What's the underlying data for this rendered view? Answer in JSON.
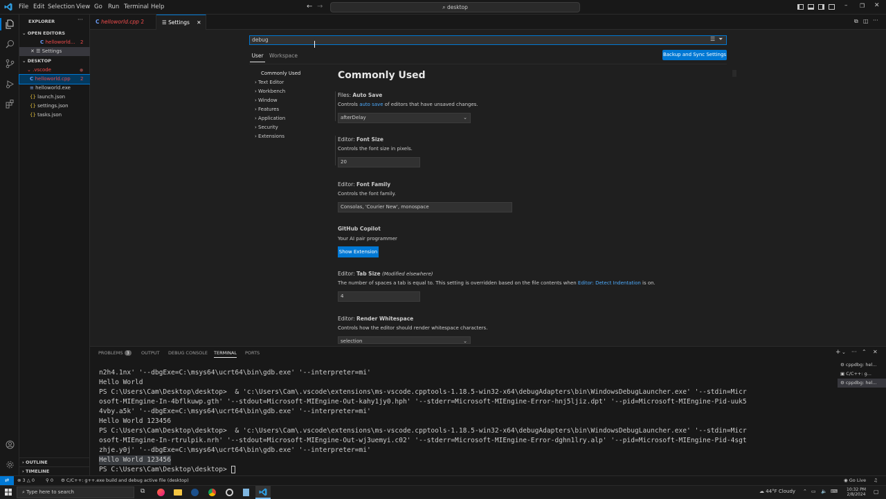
{
  "menu": [
    "File",
    "Edit",
    "Selection",
    "View",
    "Go",
    "Run",
    "Terminal",
    "Help"
  ],
  "command_center": "desktop",
  "sidebar": {
    "title": "EXPLORER",
    "open_editors_header": "OPEN EDITORS",
    "open_editors": [
      {
        "label": "helloworld...",
        "badge": "2"
      },
      {
        "label": "Settings"
      }
    ],
    "folder_header": "DESKTOP",
    "files": [
      {
        "label": ".vscode"
      },
      {
        "label": "helloworld.cpp",
        "badge": "2"
      },
      {
        "label": "helloworld.exe"
      },
      {
        "label": "launch.json"
      },
      {
        "label": "settings.json"
      },
      {
        "label": "tasks.json"
      }
    ],
    "outline": "OUTLINE",
    "timeline": "TIMELINE"
  },
  "tabs": [
    {
      "label": "helloworld.cpp",
      "badge": "2"
    },
    {
      "label": "Settings"
    }
  ],
  "settings": {
    "search_value": "debug",
    "scope_tabs": [
      "User",
      "Workspace"
    ],
    "sync_button": "Backup and Sync Settings",
    "toc": [
      "Commonly Used",
      "Text Editor",
      "Workbench",
      "Window",
      "Features",
      "Application",
      "Security",
      "Extensions"
    ],
    "heading": "Commonly Used",
    "items": [
      {
        "category": "Files: ",
        "name": "Auto Save",
        "desc_pre": "Controls ",
        "desc_link": "auto save",
        "desc_post": " of editors that have unsaved changes.",
        "value": "afterDelay"
      },
      {
        "category": "Editor: ",
        "name": "Font Size",
        "desc": "Controls the font size in pixels.",
        "value": "20"
      },
      {
        "category": "Editor: ",
        "name": "Font Family",
        "desc": "Controls the font family.",
        "value": "Consolas, 'Courier New', monospace"
      },
      {
        "name": "GitHub Copilot",
        "desc": "Your AI pair programmer",
        "button": "Show Extension"
      },
      {
        "category": "Editor: ",
        "name": "Tab Size",
        "modified": "(Modified elsewhere)",
        "desc_pre": "The number of spaces a tab is equal to. This setting is overridden based on the file contents when ",
        "desc_link": "Editor: Detect Indentation",
        "desc_post": " is on.",
        "value": "4"
      },
      {
        "category": "Editor: ",
        "name": "Render Whitespace",
        "desc": "Controls how the editor should render whitespace characters.",
        "value": "selection"
      }
    ]
  },
  "panel": {
    "tabs": [
      "PROBLEMS",
      "OUTPUT",
      "DEBUG CONSOLE",
      "TERMINAL",
      "PORTS"
    ],
    "problems_count": "3",
    "terminals": [
      "cppdbg: hel...",
      "C/C++: g...",
      "cppdbg: hel..."
    ],
    "terminal_lines": [
      "n2h4.1nx' '--dbgExe=C:\\msys64\\ucrt64\\bin\\gdb.exe' '--interpreter=mi'",
      "Hello World",
      "PS C:\\Users\\Cam\\Desktop\\desktop>  & 'c:\\Users\\Cam\\.vscode\\extensions\\ms-vscode.cpptools-1.18.5-win32-x64\\debugAdapters\\bin\\WindowsDebugLauncher.exe' '--stdin=Micr",
      "osoft-MIEngine-In-4bflkuwp.gth' '--stdout=Microsoft-MIEngine-Out-kahy1jy0.hph' '--stderr=Microsoft-MIEngine-Error-hnj5ljiz.dpt' '--pid=Microsoft-MIEngine-Pid-uuk5",
      "4vby.a5k' '--dbgExe=C:\\msys64\\ucrt64\\bin\\gdb.exe' '--interpreter=mi'",
      "Hello World 123456",
      "PS C:\\Users\\Cam\\Desktop\\desktop>  & 'c:\\Users\\Cam\\.vscode\\extensions\\ms-vscode.cpptools-1.18.5-win32-x64\\debugAdapters\\bin\\WindowsDebugLauncher.exe' '--stdin=Micr",
      "osoft-MIEngine-In-rtrulpik.nrh' '--stdout=Microsoft-MIEngine-Out-wj3uemyi.c02' '--stderr=Microsoft-MIEngine-Error-dghn1lry.alp' '--pid=Microsoft-MIEngine-Pid-4sgt",
      "zhje.y0j' '--dbgExe=C:\\msys64\\ucrt64\\bin\\gdb.exe' '--interpreter=mi'",
      "Hello World 123456",
      "PS C:\\Users\\Cam\\Desktop\\desktop> "
    ]
  },
  "status": {
    "errors": "3",
    "warnings": "0",
    "ports": "0",
    "task": "C/C++: g++.exe build and debug active file (desktop)",
    "golive": "Go Live"
  },
  "taskbar": {
    "search_placeholder": "Type here to search",
    "weather": "44°F  Cloudy",
    "time": "10:32 PM",
    "date": "2/8/2024"
  },
  "colors": {
    "accent": "#0078d4",
    "error": "#f14c4c",
    "link": "#4daafc"
  }
}
